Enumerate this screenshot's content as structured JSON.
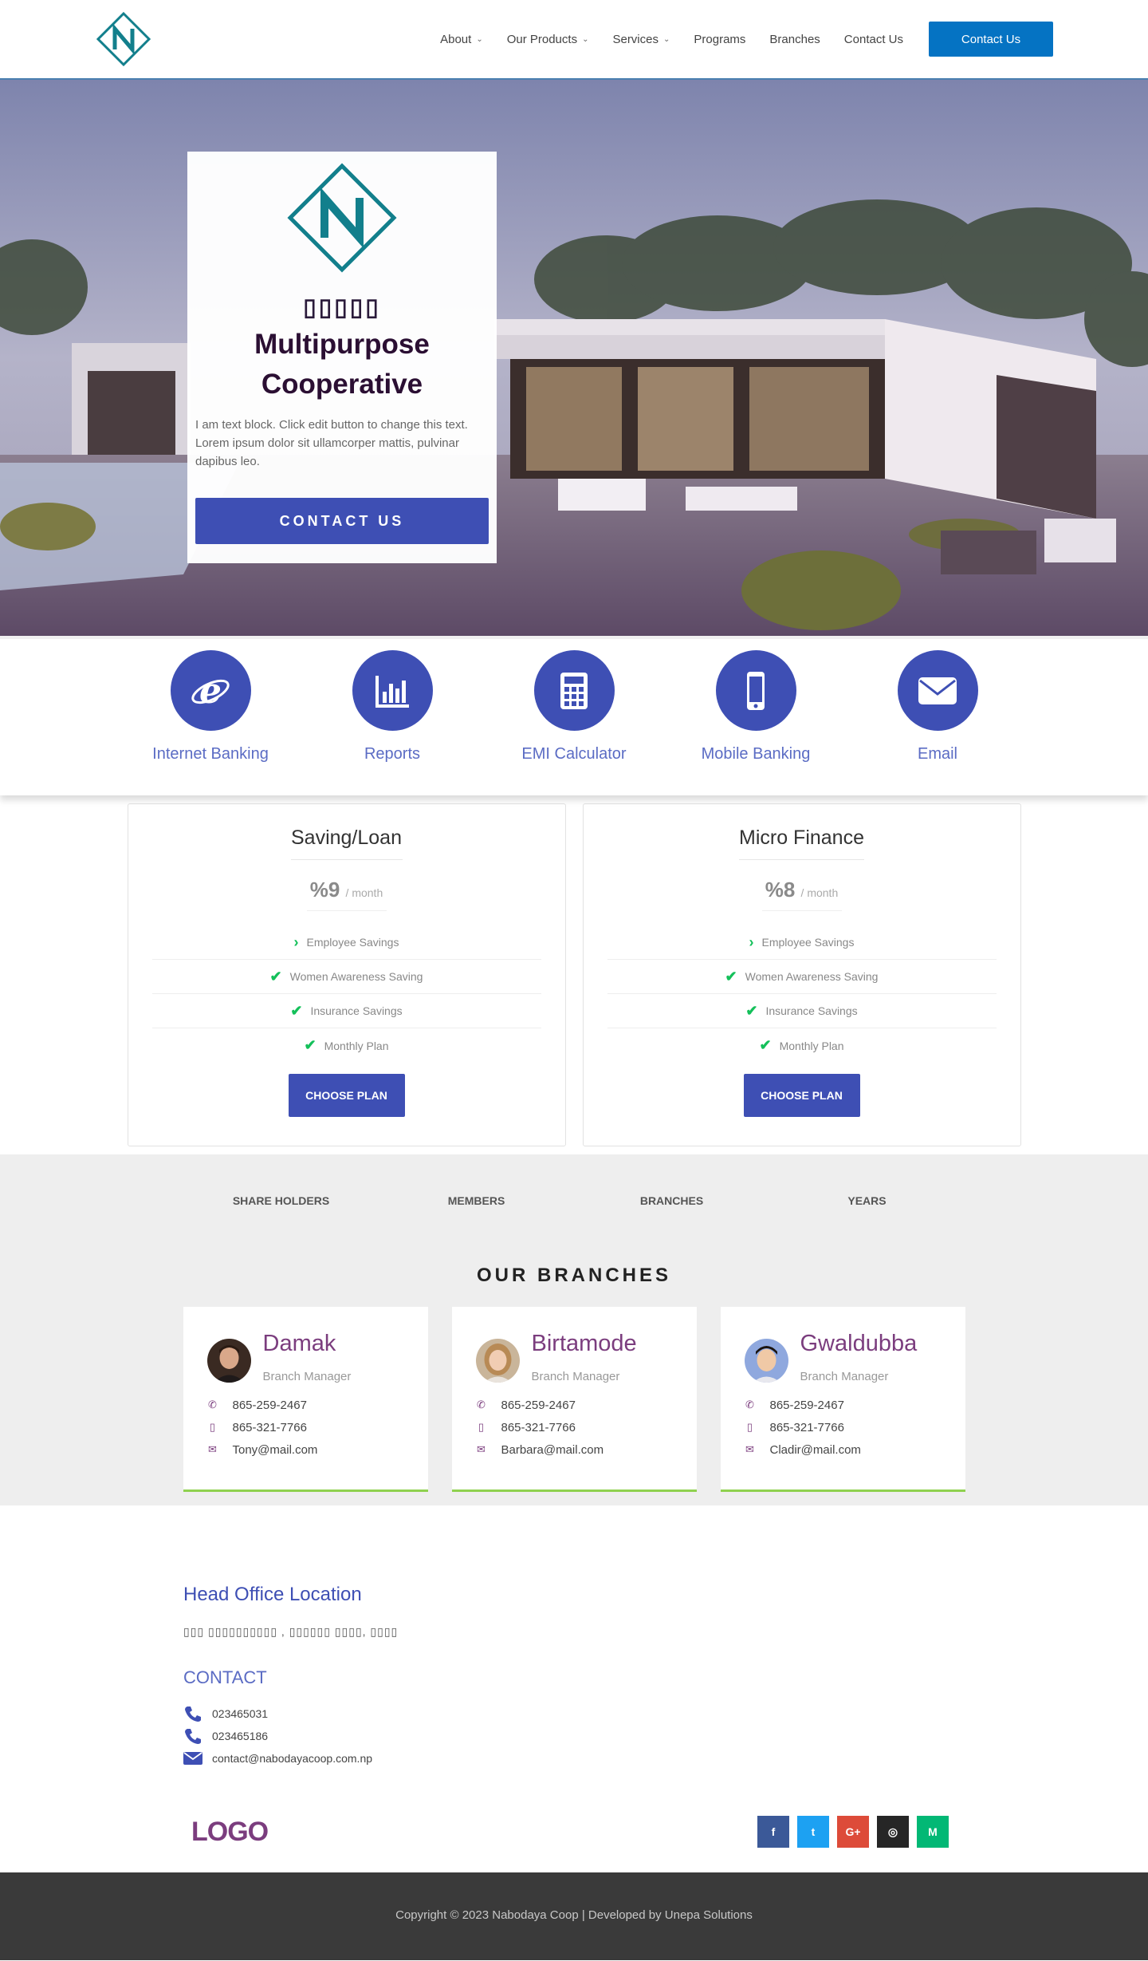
{
  "header": {
    "nav": [
      {
        "label": "About",
        "dropdown": true
      },
      {
        "label": "Our Products",
        "dropdown": true
      },
      {
        "label": "Services",
        "dropdown": true
      },
      {
        "label": "Programs",
        "dropdown": false
      },
      {
        "label": "Branches",
        "dropdown": false
      },
      {
        "label": "Contact Us",
        "dropdown": false
      }
    ],
    "cta_label": "Contact Us"
  },
  "hero": {
    "tagline_glyphs": "▯▯▯▯▯",
    "title_line1": "Multipurpose",
    "title_line2": "Cooperative",
    "body": "I am text block. Click edit button to change this text. Lorem ipsum dolor sit ullamcorper mattis, pulvinar dapibus leo.",
    "button_label": "CONTACT US"
  },
  "services": [
    {
      "label": "Internet Banking",
      "icon": "internet-explorer-icon"
    },
    {
      "label": "Reports",
      "icon": "bar-chart-icon"
    },
    {
      "label": "EMI Calculator",
      "icon": "calculator-icon"
    },
    {
      "label": "Mobile Banking",
      "icon": "mobile-phone-icon"
    },
    {
      "label": "Email",
      "icon": "envelope-icon"
    }
  ],
  "plans": [
    {
      "title": "Saving/Loan",
      "price": "%9",
      "period": "/ month",
      "features": [
        {
          "label": "Employee Savings",
          "mark": "›"
        },
        {
          "label": "Women Awareness Saving",
          "mark": "✔"
        },
        {
          "label": "Insurance Savings",
          "mark": "✔"
        },
        {
          "label": "Monthly Plan",
          "mark": "✔"
        }
      ],
      "button_label": "CHOOSE PLAN"
    },
    {
      "title": "Micro Finance",
      "price": "%8",
      "period": "/ month",
      "features": [
        {
          "label": "Employee Savings",
          "mark": "›"
        },
        {
          "label": "Women Awareness Saving",
          "mark": "✔"
        },
        {
          "label": "Insurance Savings",
          "mark": "✔"
        },
        {
          "label": "Monthly Plan",
          "mark": "✔"
        }
      ],
      "button_label": "CHOOSE PLAN"
    }
  ],
  "stats": [
    "SHARE HOLDERS",
    "MEMBERS",
    "BRANCHES",
    "YEARS"
  ],
  "branches": {
    "title": "OUR BRANCHES",
    "items": [
      {
        "name": "Damak",
        "role": "Branch Manager",
        "phone": "865-259-2467",
        "mobile": "865-321-7766",
        "email": "Tony@mail.com"
      },
      {
        "name": "Birtamode",
        "role": "Branch Manager",
        "phone": "865-259-2467",
        "mobile": "865-321-7766",
        "email": "Barbara@mail.com"
      },
      {
        "name": "Gwaldubba",
        "role": "Branch Manager",
        "phone": "865-259-2467",
        "mobile": "865-321-7766",
        "email": "Cladir@mail.com"
      }
    ]
  },
  "info": {
    "head_office_title": "Head Office Location",
    "address": "▯▯▯ ▯▯▯▯▯▯▯▯▯▯ , ▯▯▯▯▯▯ ▯▯▯▯, ▯▯▯▯",
    "contact_title": "CONTACT",
    "phone1": "023465031",
    "phone2": "023465186",
    "email": "contact@nabodayacoop.com.np",
    "logo_text": "LOGO"
  },
  "socials": [
    {
      "label": "f",
      "icon": "facebook-icon",
      "color": "#3b5998"
    },
    {
      "label": "t",
      "icon": "twitter-icon",
      "color": "#1da1f2"
    },
    {
      "label": "G+",
      "icon": "google-plus-icon",
      "color": "#dd4b39"
    },
    {
      "label": "◎",
      "icon": "instagram-icon",
      "color": "#262626"
    },
    {
      "label": "M",
      "icon": "medium-icon",
      "color": "#02b875"
    }
  ],
  "footer": {
    "copyright": "Copyright © 2023 Nabodaya Coop | Developed by Unepa Solutions"
  },
  "colors": {
    "primary": "#3e4fb4",
    "header_cta": "#0573c3",
    "accent_purple": "#7b3d7e",
    "logo_teal": "#127f8c",
    "check_green": "#14c05a",
    "branch_border": "#8fd14f"
  }
}
